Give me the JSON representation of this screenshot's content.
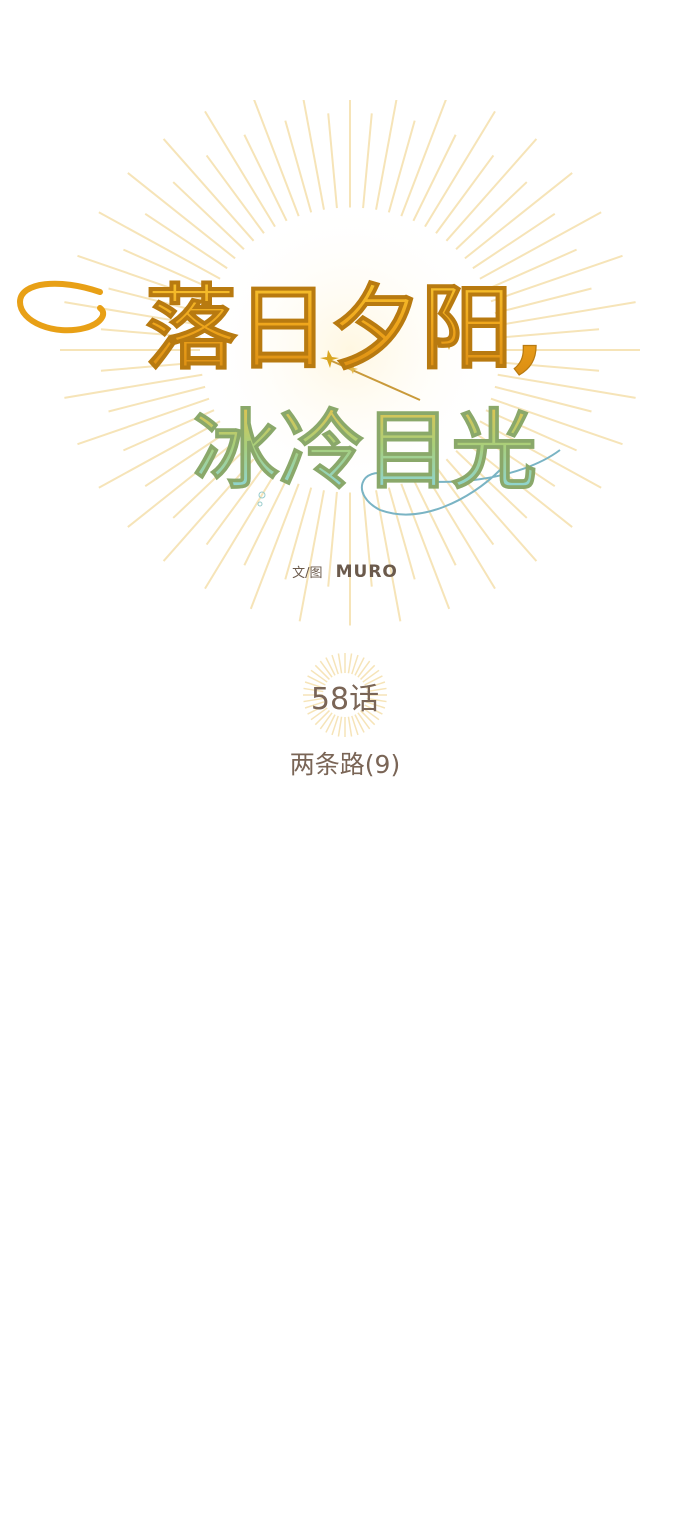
{
  "cover": {
    "title_line1": "落日夕阳,",
    "title_line2": "冰冷目光",
    "credit_label": "文/图",
    "credit_name": "MURO"
  },
  "episode": {
    "number": "58话",
    "title": "两条路(9)"
  },
  "colors": {
    "gold": "#f0b020",
    "orange": "#e07a10",
    "teal": "#7fd4e0",
    "brown_text": "#7a6556",
    "sunburst": "#f6e4b8"
  }
}
